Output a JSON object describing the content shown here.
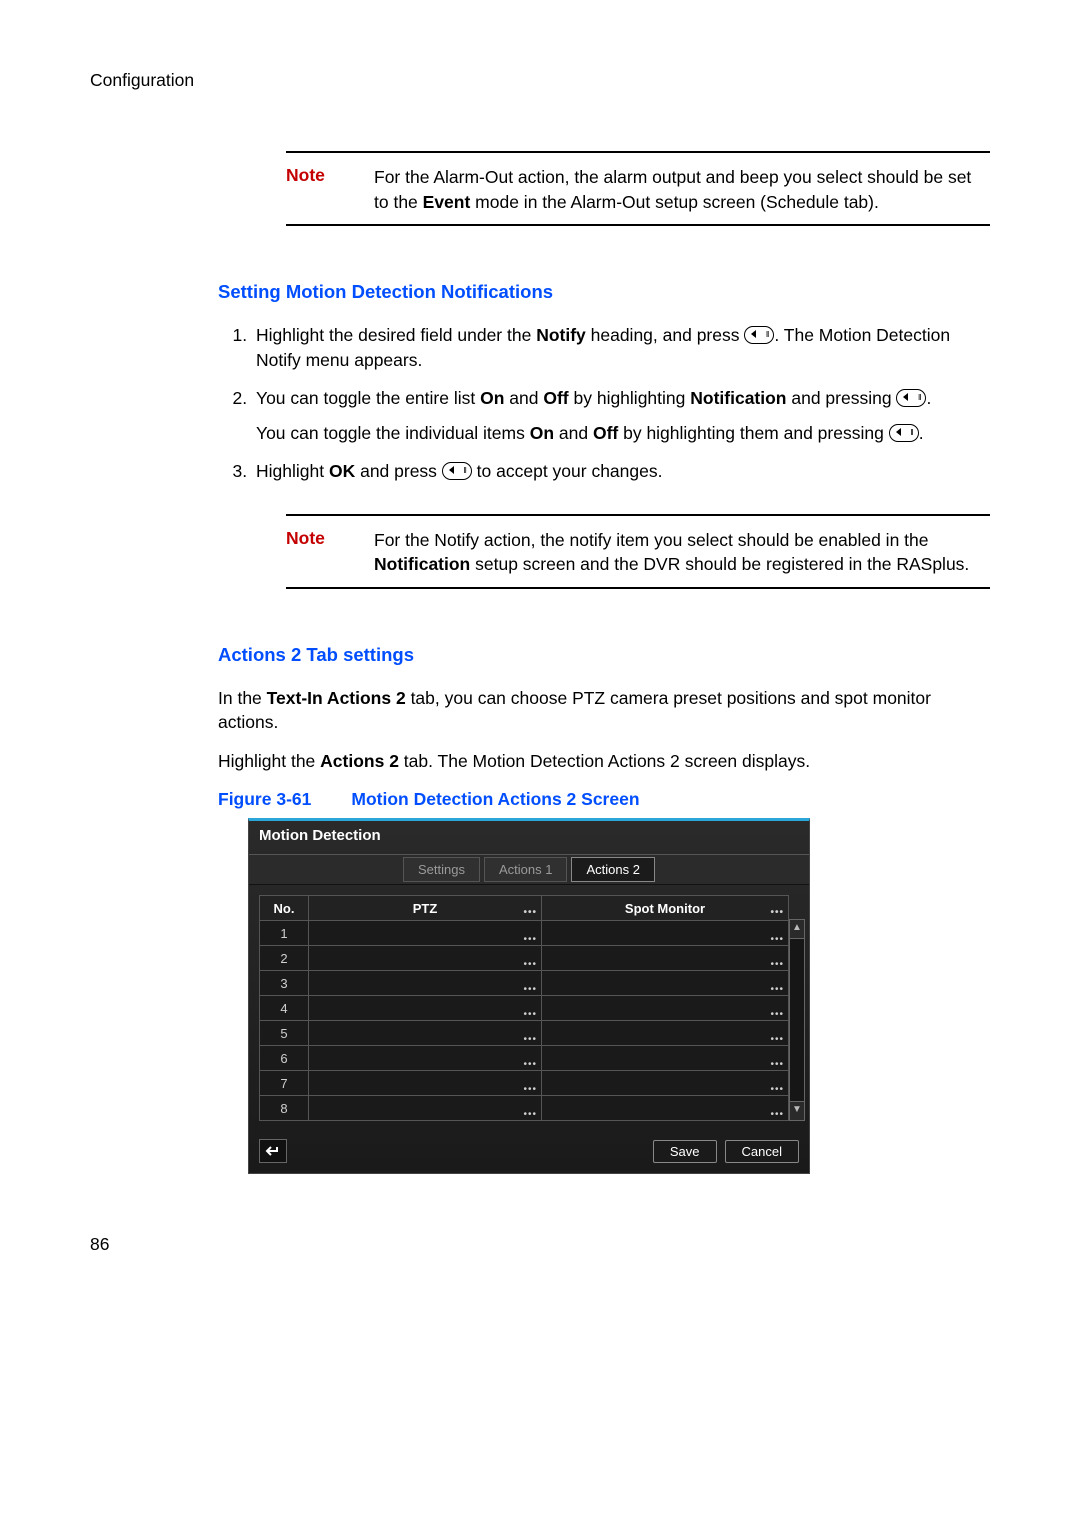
{
  "running_head": "Configuration",
  "page_number": "86",
  "note1": {
    "label": "Note",
    "text_a": "For the Alarm-Out action, the alarm output and beep you select should be set to the ",
    "text_b_strong": "Event",
    "text_c": " mode in the Alarm-Out setup screen (Schedule tab)."
  },
  "sec1_title": "Setting Motion Detection Notifications",
  "steps1": {
    "s1_a": "Highlight the desired field under the ",
    "s1_b_strong": "Notify",
    "s1_c": " heading, and press ",
    "s1_d": ". The Motion Detection Notify menu appears.",
    "s2_a": "You can toggle the entire list ",
    "s2_on": "On",
    "s2_and1": " and ",
    "s2_off": "Off",
    "s2_b": " by highlighting ",
    "s2_notif": "Notification",
    "s2_c": " and pressing ",
    "s2_d": ".",
    "s2_sub_a": "You can toggle the individual items ",
    "s2_sub_b": " by highlighting them and pressing ",
    "s2_sub_c": ".",
    "s3_a": "Highlight ",
    "s3_ok": "OK",
    "s3_b": " and press ",
    "s3_c": " to accept your changes."
  },
  "note2": {
    "label": "Note",
    "text_a": "For the Notify action, the notify item you select should be enabled in the ",
    "text_b_strong": "Notification",
    "text_c": " setup screen and the DVR should be registered in the RASplus."
  },
  "sec2_title": "Actions 2 Tab settings",
  "sec2_p1_a": "In the ",
  "sec2_p1_b_strong": "Text-In Actions 2",
  "sec2_p1_c": " tab, you can choose PTZ camera preset positions and spot monitor actions.",
  "sec2_p2_a": "Highlight the ",
  "sec2_p2_b_strong": "Actions 2",
  "sec2_p2_c": " tab. The Motion Detection Actions 2 screen displays.",
  "fig": {
    "label": "Figure 3-61",
    "title": "Motion Detection Actions 2 Screen"
  },
  "dvr": {
    "title": "Motion Detection",
    "tabs": [
      "Settings",
      "Actions 1",
      "Actions 2"
    ],
    "active_tab": 2,
    "headers": {
      "no": "No.",
      "ptz": "PTZ",
      "spot": "Spot Monitor"
    },
    "rows": [
      "1",
      "2",
      "3",
      "4",
      "5",
      "6",
      "7",
      "8"
    ],
    "save": "Save",
    "cancel": "Cancel"
  }
}
